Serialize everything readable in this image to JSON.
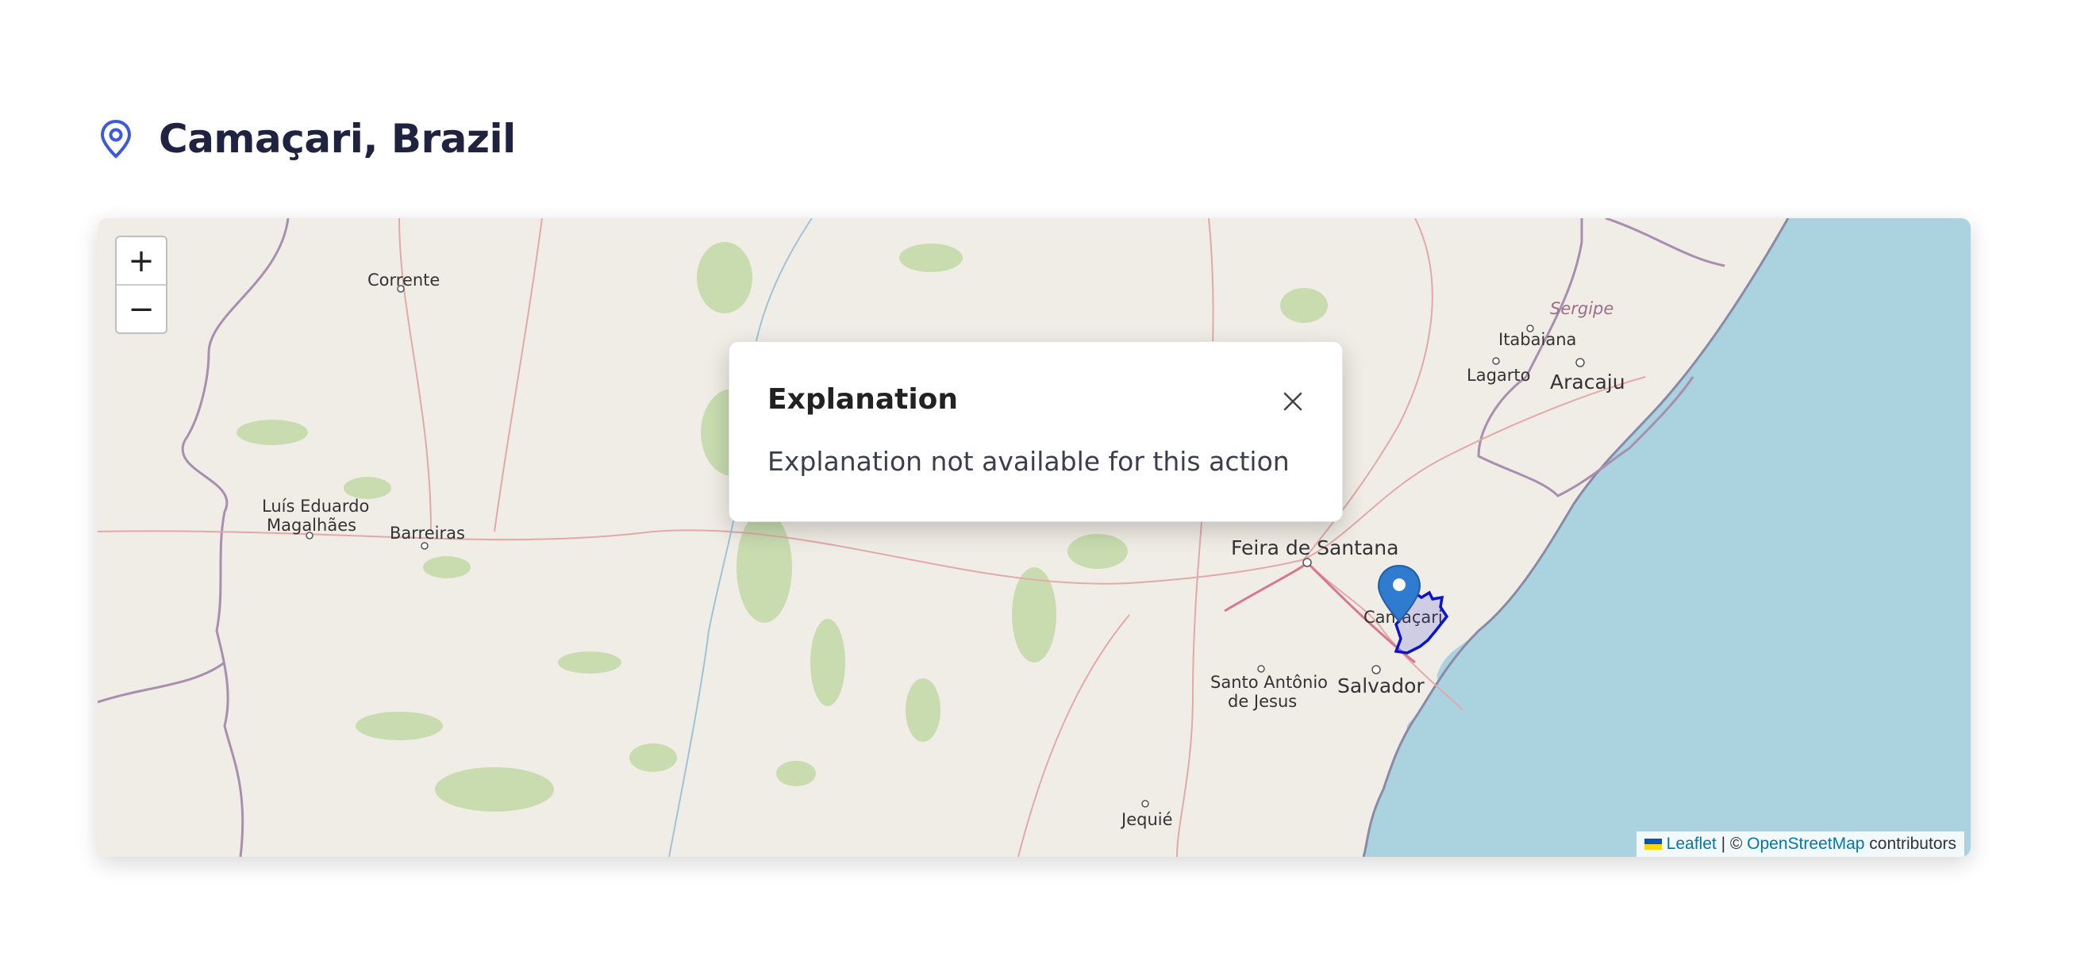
{
  "header": {
    "title": "Camaçari, Brazil",
    "icon": "map-pin-icon"
  },
  "map": {
    "zoom_in": "+",
    "zoom_out": "−",
    "places": {
      "corrente": "Corrente",
      "luis_eduardo_1": "Luís Eduardo",
      "luis_eduardo_2": "Magalhães",
      "barreiras": "Barreiras",
      "sergipe": "Sergipe",
      "itabaiana": "Itabaiana",
      "lagarto": "Lagarto",
      "aracaju": "Aracaju",
      "feira": "Feira de Santana",
      "camacari": "Camaçari",
      "santo_antonio_1": "Santo Antônio",
      "santo_antonio_2": "de Jesus",
      "salvador": "Salvador",
      "jequie": "Jequié"
    },
    "attribution": {
      "leaflet": "Leaflet",
      "separator": "| ©",
      "osm": "OpenStreetMap",
      "contributors": "contributors"
    },
    "colors": {
      "sea": "#aad3df",
      "land": "#f0ede6",
      "forest": "#c8dcb0",
      "boundary": "#a88fb0",
      "highlight": "#0a14c8",
      "marker": "#2f7bd0"
    }
  },
  "modal": {
    "title": "Explanation",
    "body": "Explanation not available for this action",
    "close_icon": "close-icon"
  }
}
